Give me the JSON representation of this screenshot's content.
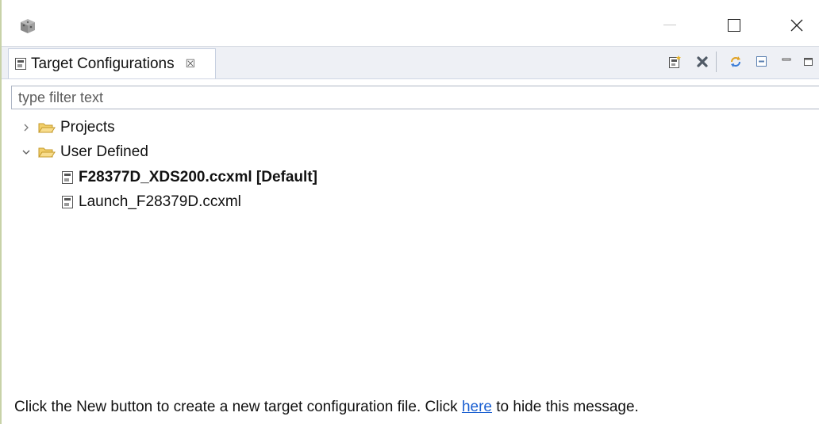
{
  "window": {
    "minimize_label": "—",
    "maximize_label": "☐",
    "close_label": "✕"
  },
  "view": {
    "tab_title": "Target Configurations",
    "tab_close_glyph": "☒",
    "toolbar": [
      "new-config-icon",
      "delete-icon",
      "refresh-icon",
      "collapse-all-icon",
      "minimize-view-icon",
      "maximize-view-icon"
    ]
  },
  "filter": {
    "placeholder": "type filter text",
    "value": ""
  },
  "tree": {
    "projects": {
      "label": "Projects",
      "expanded": false
    },
    "user_defined": {
      "label": "User Defined",
      "expanded": true,
      "children": [
        {
          "label": "F28377D_XDS200.ccxml [Default]",
          "bold": true
        },
        {
          "label": "Launch_F28379D.ccxml",
          "bold": false
        }
      ]
    }
  },
  "footer": {
    "before": "Click the New button to create a new target configuration file. Click ",
    "link": "here",
    "after": " to hide this message."
  },
  "colors": {
    "link": "#1a5fd1",
    "folder": "#e9b949",
    "tab_bar": "#eef0f5"
  }
}
